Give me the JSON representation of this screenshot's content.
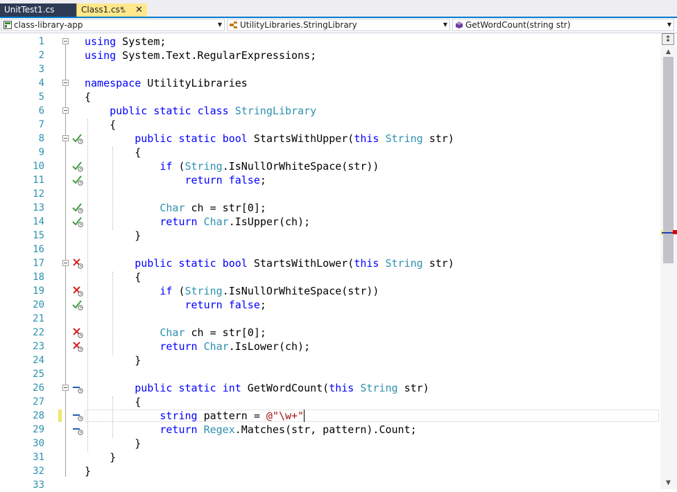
{
  "tabs": [
    {
      "label": "UnitTest1.cs",
      "active": false
    },
    {
      "label": "Class1.cs*",
      "active": true,
      "pin_icon": "pin-icon",
      "close_icon": "close-icon"
    }
  ],
  "navbar": {
    "project": "class-library-app",
    "class": "UtilityLibraries.StringLibrary",
    "member": "GetWordCount(string str)"
  },
  "colors": {
    "keyword": "#0000ff",
    "type": "#2b91af",
    "string": "#a31515",
    "line_number": "#2b91af",
    "active_tab": "#ffe88c",
    "inactive_tab": "#2d3b55",
    "accent": "#007acc",
    "test_pass": "#3c9e3c",
    "test_fail": "#d32020",
    "test_none": "#1e5aa8"
  },
  "lines": [
    {
      "n": "1",
      "collapse": true,
      "tokens": [
        {
          "t": "using",
          "c": "kw"
        },
        {
          "t": " System;"
        }
      ]
    },
    {
      "n": "2",
      "tokens": [
        {
          "t": "using",
          "c": "kw"
        },
        {
          "t": " System.Text.RegularExpressions;"
        }
      ]
    },
    {
      "n": "3",
      "tokens": []
    },
    {
      "n": "4",
      "collapse": true,
      "tokens": [
        {
          "t": "namespace",
          "c": "kw"
        },
        {
          "t": " UtilityLibraries"
        }
      ]
    },
    {
      "n": "5",
      "tokens": [
        {
          "t": "{"
        }
      ]
    },
    {
      "n": "6",
      "collapse": true,
      "tokens": [
        {
          "t": "    "
        },
        {
          "t": "public",
          "c": "kw"
        },
        {
          "t": " "
        },
        {
          "t": "static",
          "c": "kw"
        },
        {
          "t": " "
        },
        {
          "t": "class",
          "c": "kw"
        },
        {
          "t": " "
        },
        {
          "t": "StringLibrary",
          "c": "ty"
        }
      ]
    },
    {
      "n": "7",
      "tokens": [
        {
          "t": "    {"
        }
      ]
    },
    {
      "n": "8",
      "collapse": true,
      "test": "pass",
      "tokens": [
        {
          "t": "        "
        },
        {
          "t": "public",
          "c": "kw"
        },
        {
          "t": " "
        },
        {
          "t": "static",
          "c": "kw"
        },
        {
          "t": " "
        },
        {
          "t": "bool",
          "c": "kw"
        },
        {
          "t": " StartsWithUpper("
        },
        {
          "t": "this",
          "c": "kw"
        },
        {
          "t": " "
        },
        {
          "t": "String",
          "c": "ty"
        },
        {
          "t": " str)"
        }
      ]
    },
    {
      "n": "9",
      "tokens": [
        {
          "t": "        {"
        }
      ]
    },
    {
      "n": "10",
      "test": "pass",
      "tokens": [
        {
          "t": "            "
        },
        {
          "t": "if",
          "c": "kw"
        },
        {
          "t": " ("
        },
        {
          "t": "String",
          "c": "ty"
        },
        {
          "t": ".IsNullOrWhiteSpace(str))"
        }
      ]
    },
    {
      "n": "11",
      "test": "pass",
      "tokens": [
        {
          "t": "                "
        },
        {
          "t": "return",
          "c": "kw"
        },
        {
          "t": " "
        },
        {
          "t": "false",
          "c": "kw"
        },
        {
          "t": ";"
        }
      ]
    },
    {
      "n": "12",
      "tokens": []
    },
    {
      "n": "13",
      "test": "pass",
      "tokens": [
        {
          "t": "            "
        },
        {
          "t": "Char",
          "c": "ty"
        },
        {
          "t": " ch = str[0];"
        }
      ]
    },
    {
      "n": "14",
      "test": "pass",
      "tokens": [
        {
          "t": "            "
        },
        {
          "t": "return",
          "c": "kw"
        },
        {
          "t": " "
        },
        {
          "t": "Char",
          "c": "ty"
        },
        {
          "t": ".IsUpper(ch);"
        }
      ]
    },
    {
      "n": "15",
      "tokens": [
        {
          "t": "        }"
        }
      ]
    },
    {
      "n": "16",
      "tokens": []
    },
    {
      "n": "17",
      "collapse": true,
      "test": "fail",
      "tokens": [
        {
          "t": "        "
        },
        {
          "t": "public",
          "c": "kw"
        },
        {
          "t": " "
        },
        {
          "t": "static",
          "c": "kw"
        },
        {
          "t": " "
        },
        {
          "t": "bool",
          "c": "kw"
        },
        {
          "t": " StartsWithLower("
        },
        {
          "t": "this",
          "c": "kw"
        },
        {
          "t": " "
        },
        {
          "t": "String",
          "c": "ty"
        },
        {
          "t": " str)"
        }
      ]
    },
    {
      "n": "18",
      "tokens": [
        {
          "t": "        {"
        }
      ]
    },
    {
      "n": "19",
      "test": "fail",
      "tokens": [
        {
          "t": "            "
        },
        {
          "t": "if",
          "c": "kw"
        },
        {
          "t": " ("
        },
        {
          "t": "String",
          "c": "ty"
        },
        {
          "t": ".IsNullOrWhiteSpace(str))"
        }
      ]
    },
    {
      "n": "20",
      "test": "pass",
      "tokens": [
        {
          "t": "                "
        },
        {
          "t": "return",
          "c": "kw"
        },
        {
          "t": " "
        },
        {
          "t": "false",
          "c": "kw"
        },
        {
          "t": ";"
        }
      ]
    },
    {
      "n": "21",
      "tokens": []
    },
    {
      "n": "22",
      "test": "fail",
      "tokens": [
        {
          "t": "            "
        },
        {
          "t": "Char",
          "c": "ty"
        },
        {
          "t": " ch = str[0];"
        }
      ]
    },
    {
      "n": "23",
      "test": "fail",
      "tokens": [
        {
          "t": "            "
        },
        {
          "t": "return",
          "c": "kw"
        },
        {
          "t": " "
        },
        {
          "t": "Char",
          "c": "ty"
        },
        {
          "t": ".IsLower(ch);"
        }
      ]
    },
    {
      "n": "24",
      "tokens": [
        {
          "t": "        }"
        }
      ]
    },
    {
      "n": "25",
      "tokens": []
    },
    {
      "n": "26",
      "collapse": true,
      "test": "none",
      "tokens": [
        {
          "t": "        "
        },
        {
          "t": "public",
          "c": "kw"
        },
        {
          "t": " "
        },
        {
          "t": "static",
          "c": "kw"
        },
        {
          "t": " "
        },
        {
          "t": "int",
          "c": "kw"
        },
        {
          "t": " GetWordCount("
        },
        {
          "t": "this",
          "c": "kw"
        },
        {
          "t": " "
        },
        {
          "t": "String",
          "c": "ty"
        },
        {
          "t": " str)"
        }
      ]
    },
    {
      "n": "27",
      "tokens": [
        {
          "t": "        {"
        }
      ]
    },
    {
      "n": "28",
      "test": "none",
      "modified": true,
      "current": true,
      "tokens": [
        {
          "t": "            "
        },
        {
          "t": "string",
          "c": "kw"
        },
        {
          "t": " pattern = "
        },
        {
          "t": "@\"\\w+\"",
          "c": "st"
        }
      ]
    },
    {
      "n": "29",
      "test": "none",
      "tokens": [
        {
          "t": "            "
        },
        {
          "t": "return",
          "c": "kw"
        },
        {
          "t": " "
        },
        {
          "t": "Regex",
          "c": "ty"
        },
        {
          "t": ".Matches(str, pattern).Count;"
        }
      ]
    },
    {
      "n": "30",
      "tokens": [
        {
          "t": "        }"
        }
      ]
    },
    {
      "n": "31",
      "tokens": [
        {
          "t": "    }"
        }
      ]
    },
    {
      "n": "32",
      "tokens": [
        {
          "t": "}"
        }
      ]
    },
    {
      "n": "33",
      "tokens": []
    }
  ]
}
